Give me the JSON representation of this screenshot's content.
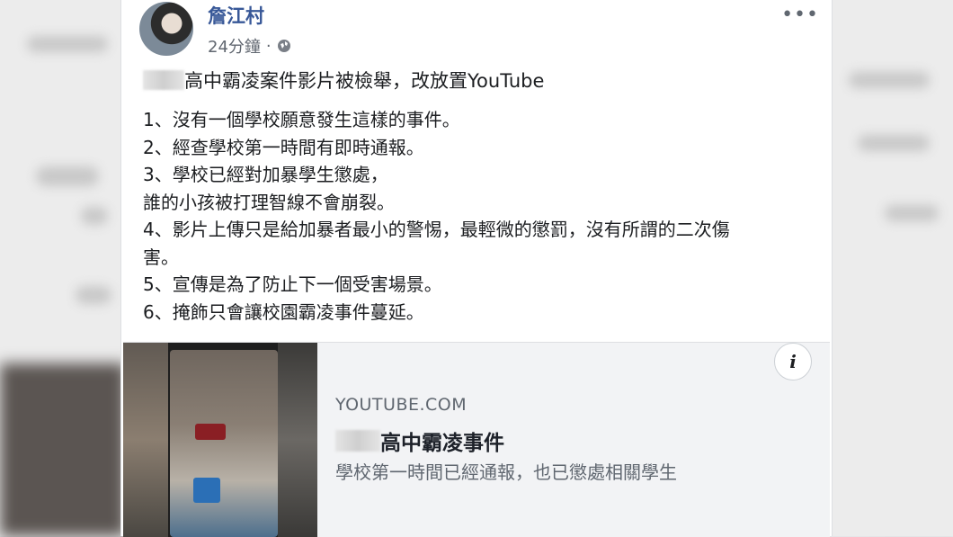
{
  "post": {
    "author": "詹江村",
    "time": "24分鐘",
    "separator": "·",
    "title_line": "高中霸凌案件影片被檢舉，改放置YouTube",
    "lines": [
      "1、沒有一個學校願意發生這樣的事件。",
      "2、經查學校第一時間有即時通報。",
      "3、學校已經對加暴學生懲處，",
      "誰的小孩被打理智線不會崩裂。",
      "4、影片上傳只是給加暴者最小的警惕，最輕微的懲罰，沒有所謂的二次傷",
      "害。",
      "5、宣傳是為了防止下一個受害場景。",
      "6、掩飾只會讓校園霸凌事件蔓延。"
    ],
    "more": "•••"
  },
  "link": {
    "domain": "YOUTUBE.COM",
    "title": "高中霸凌事件",
    "description": "學校第一時間已經通報，也已懲處相關學生",
    "info_icon": "i"
  },
  "colors": {
    "author": "#385898",
    "text": "#1c1e21",
    "secondary": "#606770"
  }
}
